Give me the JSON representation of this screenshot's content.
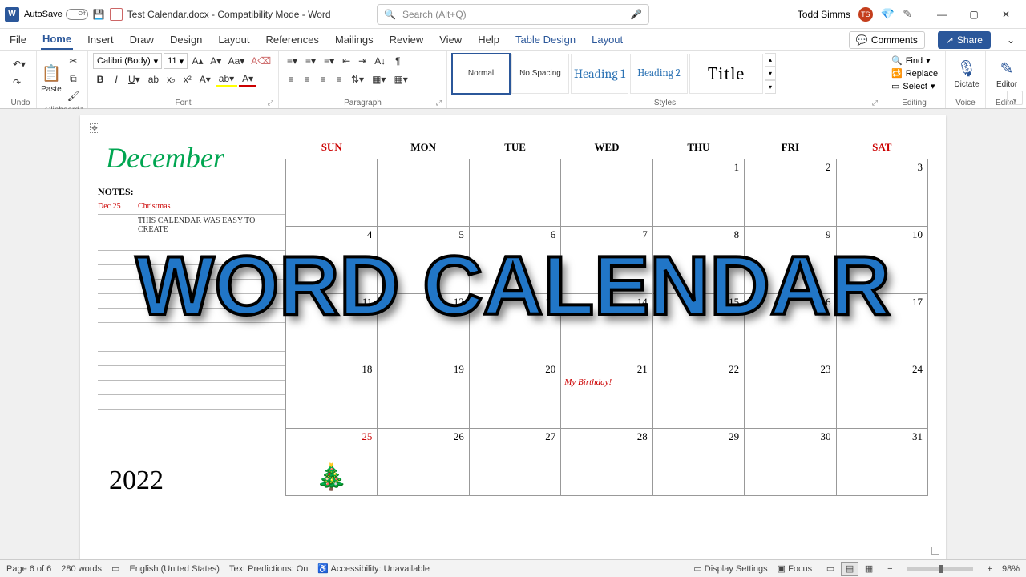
{
  "titlebar": {
    "autosave_label": "AutoSave",
    "autosave_state": "Off",
    "doc_title": "Test Calendar.docx - Compatibility Mode - Word",
    "search_placeholder": "Search (Alt+Q)",
    "user_name": "Todd Simms",
    "user_initials": "TS"
  },
  "tabs": {
    "file": "File",
    "home": "Home",
    "insert": "Insert",
    "draw": "Draw",
    "design": "Design",
    "layout": "Layout",
    "references": "References",
    "mailings": "Mailings",
    "review": "Review",
    "view": "View",
    "help": "Help",
    "table_design": "Table Design",
    "layout2": "Layout",
    "comments": "Comments",
    "share": "Share"
  },
  "ribbon": {
    "undo_label": "Undo",
    "clipboard_label": "Clipboard",
    "paste_label": "Paste",
    "font_label": "Font",
    "font_name": "Calibri (Body)",
    "font_size": "11",
    "paragraph_label": "Paragraph",
    "styles_label": "Styles",
    "styles": {
      "normal": "Normal",
      "nospacing": "No Spacing",
      "h1": "Heading 1",
      "h2": "Heading 2",
      "title": "Title"
    },
    "editing": {
      "label": "Editing",
      "find": "Find",
      "replace": "Replace",
      "select": "Select"
    },
    "dictate": "Dictate",
    "voice_label": "Voice",
    "editor": "Editor",
    "editor_label": "Editor"
  },
  "calendar": {
    "month": "December",
    "year": "2022",
    "notes_header": "NOTES:",
    "notes": [
      {
        "date": "Dec 25",
        "text": "Christmas"
      },
      {
        "date": "",
        "text": "THIS CALENDAR WAS EASY TO CREATE"
      }
    ],
    "days": [
      "SUN",
      "MON",
      "TUE",
      "WED",
      "THU",
      "FRI",
      "SAT"
    ],
    "weeks": [
      [
        "",
        "",
        "",
        "",
        "1",
        "2",
        "3"
      ],
      [
        "4",
        "5",
        "6",
        "7",
        "8",
        "9",
        "10"
      ],
      [
        "11",
        "12",
        "13",
        "14",
        "15",
        "16",
        "17"
      ],
      [
        "18",
        "19",
        "20",
        "21",
        "22",
        "23",
        "24"
      ],
      [
        "25",
        "26",
        "27",
        "28",
        "29",
        "30",
        "31"
      ]
    ],
    "events": {
      "21": "My Birthday!"
    },
    "holidays": [
      "25"
    ]
  },
  "overlay": "WORD CALENDAR",
  "status": {
    "page": "Page 6 of 6",
    "words": "280 words",
    "lang": "English (United States)",
    "predictions": "Text Predictions: On",
    "accessibility": "Accessibility: Unavailable",
    "display": "Display Settings",
    "focus": "Focus",
    "zoom": "98%"
  }
}
